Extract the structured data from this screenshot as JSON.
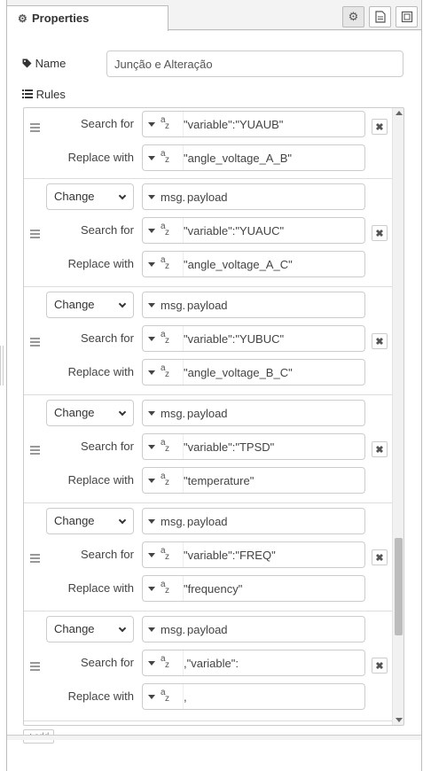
{
  "panel": {
    "tab_label": "Properties",
    "name_label": "Name",
    "name_value": "Junção e Alteração",
    "rules_label": "Rules",
    "add_label": "add"
  },
  "labels": {
    "search_for": "Search for",
    "replace_with": "Replace with",
    "msg_prefix": "msg."
  },
  "rules": [
    {
      "action": "",
      "property": "",
      "search": "\"variable\":\"YUAUB\"",
      "replace": "\"angle_voltage_A_B\""
    },
    {
      "action": "Change",
      "property": "payload",
      "search": "\"variable\":\"YUAUC\"",
      "replace": "\"angle_voltage_A_C\""
    },
    {
      "action": "Change",
      "property": "payload",
      "search": "\"variable\":\"YUBUC\"",
      "replace": "\"angle_voltage_B_C\""
    },
    {
      "action": "Change",
      "property": "payload",
      "search": "\"variable\":\"TPSD\"",
      "replace": "\"temperature\""
    },
    {
      "action": "Change",
      "property": "payload",
      "search": "\"variable\":\"FREQ\"",
      "replace": "\"frequency\""
    },
    {
      "action": "Change",
      "property": "payload",
      "search": ",\"variable\":",
      "replace": ","
    }
  ],
  "scrollbar": {
    "position_fraction": 0.84
  }
}
